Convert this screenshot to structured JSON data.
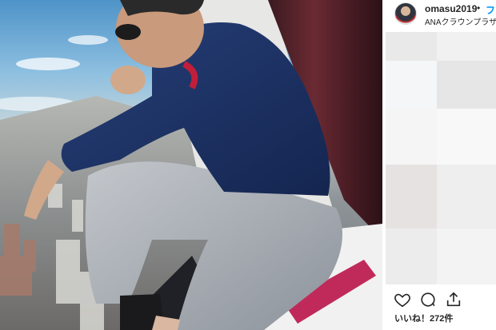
{
  "post": {
    "username": "omasu2019",
    "separator": "•",
    "follow_label": "フ",
    "location": "ANAクラウンプラザ"
  },
  "actions": {
    "like_icon": "heart-icon",
    "comment_icon": "comment-icon",
    "share_icon": "share-icon"
  },
  "likes_text": "いいね！272件",
  "colors": {
    "accent": "#0095f6",
    "text": "#262626"
  }
}
